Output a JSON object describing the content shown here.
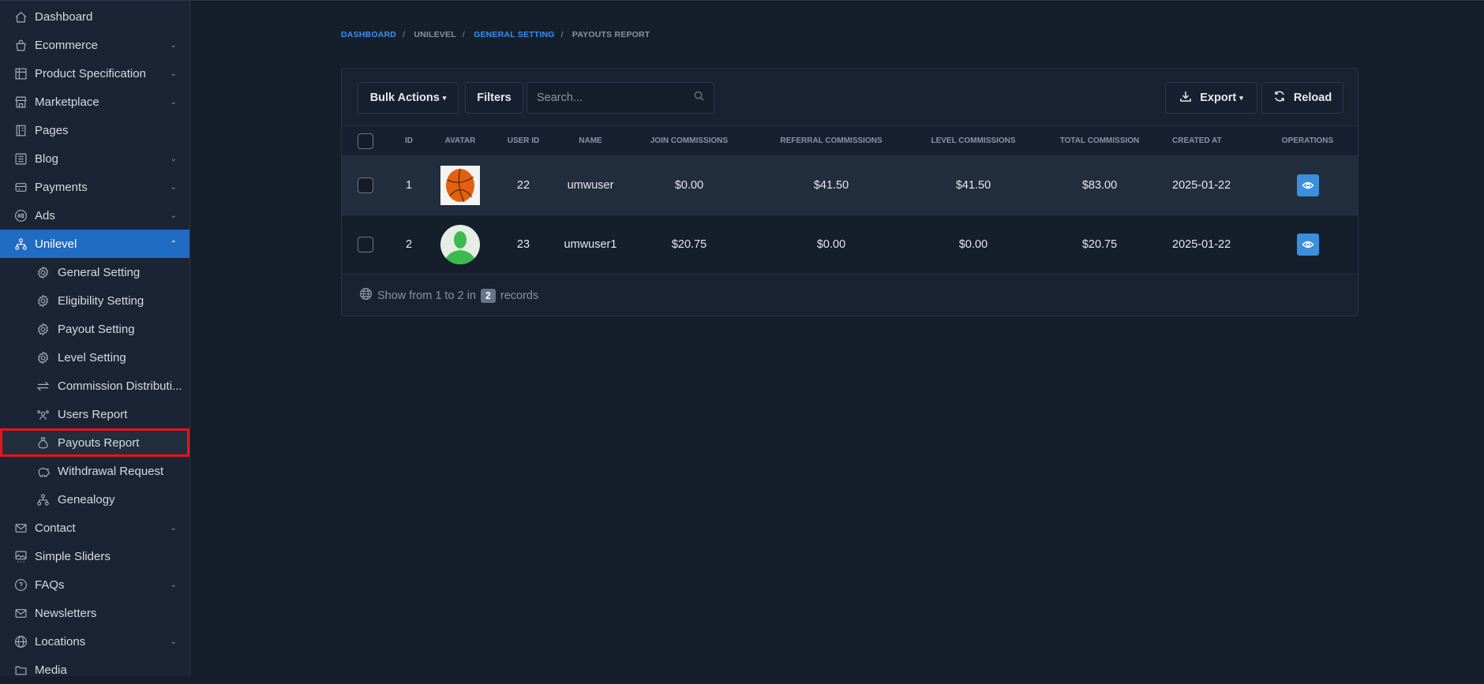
{
  "sidebar": {
    "items": [
      {
        "label": "Dashboard",
        "icon": "home-icon",
        "chev": ""
      },
      {
        "label": "Ecommerce",
        "icon": "shopping-bag-icon",
        "chev": "⌄"
      },
      {
        "label": "Product Specification",
        "icon": "table-settings-icon",
        "chev": "⌄"
      },
      {
        "label": "Marketplace",
        "icon": "store-icon",
        "chev": "⌄"
      },
      {
        "label": "Pages",
        "icon": "notebook-icon",
        "chev": ""
      },
      {
        "label": "Blog",
        "icon": "article-icon",
        "chev": "⌄"
      },
      {
        "label": "Payments",
        "icon": "credit-card-icon",
        "chev": "⌄"
      },
      {
        "label": "Ads",
        "icon": "ad-circle-icon",
        "chev": "⌄"
      },
      {
        "label": "Unilevel",
        "icon": "hierarchy-icon",
        "chev": "⌃"
      }
    ],
    "sub_items": [
      {
        "label": "General Setting",
        "icon": "gear-icon"
      },
      {
        "label": "Eligibility Setting",
        "icon": "gear-icon"
      },
      {
        "label": "Payout Setting",
        "icon": "gear-icon"
      },
      {
        "label": "Level Setting",
        "icon": "gear-icon"
      },
      {
        "label": "Commission Distributi...",
        "icon": "arrows-exchange-icon"
      },
      {
        "label": "Users Report",
        "icon": "users-icon"
      },
      {
        "label": "Payouts Report",
        "icon": "money-bag-icon"
      },
      {
        "label": "Withdrawal Request",
        "icon": "piggy-bank-icon"
      },
      {
        "label": "Genealogy",
        "icon": "hierarchy-icon"
      }
    ],
    "bottom_items": [
      {
        "label": "Contact",
        "icon": "mail-icon",
        "chev": "⌄"
      },
      {
        "label": "Simple Sliders",
        "icon": "slideshow-icon",
        "chev": ""
      },
      {
        "label": "FAQs",
        "icon": "help-circle-icon",
        "chev": "⌄"
      },
      {
        "label": "Newsletters",
        "icon": "mail-icon",
        "chev": ""
      },
      {
        "label": "Locations",
        "icon": "globe-icon",
        "chev": "⌄"
      },
      {
        "label": "Media",
        "icon": "folder-icon",
        "chev": ""
      }
    ]
  },
  "breadcrumb": [
    "DASHBOARD",
    "UNILEVEL",
    "GENERAL SETTING",
    "PAYOUTS REPORT"
  ],
  "toolbar": {
    "bulk_actions": "Bulk Actions",
    "filters": "Filters",
    "search_placeholder": "Search...",
    "export": "Export",
    "reload": "Reload"
  },
  "table": {
    "headers": [
      "ID",
      "AVATAR",
      "USER ID",
      "NAME",
      "JOIN COMMISSIONS",
      "REFERRAL COMMISSIONS",
      "LEVEL COMMISSIONS",
      "TOTAL COMMISSION",
      "CREATED AT",
      "OPERATIONS"
    ],
    "rows": [
      {
        "id": "1",
        "user_id": "22",
        "name": "umwuser",
        "join": "$0.00",
        "referral": "$41.50",
        "level": "$41.50",
        "total": "$83.00",
        "created": "2025-01-22"
      },
      {
        "id": "2",
        "user_id": "23",
        "name": "umwuser1",
        "join": "$20.75",
        "referral": "$0.00",
        "level": "$0.00",
        "total": "$20.75",
        "created": "2025-01-22"
      }
    ]
  },
  "footer": {
    "prefix": "Show from 1 to 2 in",
    "count": "2",
    "suffix": "records"
  },
  "colors": {
    "accent": "#206bc4",
    "link": "#3a8ff0",
    "highlight": "#e8141a"
  }
}
